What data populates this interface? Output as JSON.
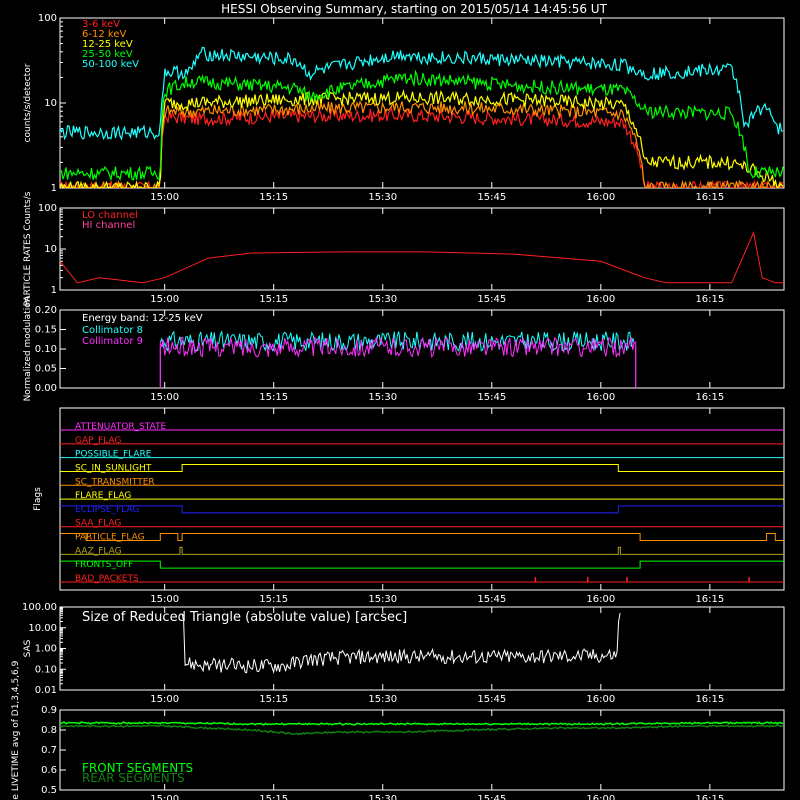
{
  "title": "HESSI Observing Summary, starting on 2015/05/14 14:45:56 UT",
  "time_ticks": [
    "15:00",
    "15:15",
    "15:30",
    "15:45",
    "16:00",
    "16:15"
  ],
  "colors": {
    "red": "#ff2020",
    "orange": "#ff9000",
    "yellow": "#ffff00",
    "green": "#00ff00",
    "cyan": "#20ffff",
    "magenta": "#ff30ff",
    "blue": "#2020ff",
    "white": "#ffffff",
    "olive": "#b0a020",
    "darkgreen": "#108010",
    "pink": "#ff40a0",
    "frame": "#ffffff"
  },
  "chart_data": [
    {
      "id": "counts",
      "type": "line",
      "ylabel": "counts/s/detector",
      "scale": "log",
      "ylim": [
        1,
        100
      ],
      "yticks": [
        "1",
        "10",
        "100"
      ],
      "series": [
        {
          "name": "3-6 keV",
          "color": "red",
          "x": [
            14.76,
            14.99,
            15.0,
            15.06,
            15.3,
            15.55,
            15.8,
            16.05,
            16.1,
            16.42
          ],
          "y": [
            1.0,
            1.0,
            7.0,
            6.5,
            7.0,
            7.2,
            6.5,
            6.0,
            1.0,
            1.0
          ]
        },
        {
          "name": "6-12 keV",
          "color": "orange",
          "x": [
            14.76,
            14.99,
            15.0,
            15.06,
            15.3,
            15.55,
            15.8,
            16.05,
            16.1,
            16.42
          ],
          "y": [
            1.0,
            1.0,
            8.0,
            8.0,
            8.5,
            9.0,
            8.5,
            7.5,
            1.0,
            1.0
          ]
        },
        {
          "name": "12-25 keV",
          "color": "yellow",
          "x": [
            14.76,
            14.99,
            15.0,
            15.06,
            15.3,
            15.55,
            15.8,
            16.05,
            16.1,
            16.3,
            16.42
          ],
          "y": [
            1.0,
            1.0,
            10.0,
            10.0,
            11.0,
            11.5,
            11.0,
            9.5,
            2.0,
            2.0,
            1.0
          ]
        },
        {
          "name": "25-50 keV",
          "color": "green",
          "x": [
            14.76,
            14.99,
            15.0,
            15.06,
            15.3,
            15.33,
            15.55,
            15.8,
            16.05,
            16.1,
            16.3,
            16.34,
            16.42
          ],
          "y": [
            1.5,
            1.5,
            14.0,
            18.0,
            15.0,
            12.0,
            20.0,
            16.0,
            14.0,
            8.0,
            7.5,
            1.5,
            1.5
          ]
        },
        {
          "name": "50-100 keV",
          "color": "cyan",
          "x": [
            14.76,
            14.99,
            15.0,
            15.06,
            15.08,
            15.3,
            15.33,
            15.55,
            15.58,
            15.8,
            16.05,
            16.1,
            16.3,
            16.33,
            16.38,
            16.4,
            16.42
          ],
          "y": [
            4.5,
            4.5,
            23.0,
            23.0,
            38.0,
            32.0,
            22.0,
            38.0,
            35.0,
            32.0,
            28.0,
            22.0,
            25.0,
            5.0,
            10.0,
            5.0,
            5.0
          ]
        }
      ]
    },
    {
      "id": "particle",
      "type": "line",
      "ylabel": "PARTICLE RATES Counts/s",
      "scale": "log",
      "ylim": [
        1,
        100
      ],
      "yticks": [
        "1",
        "10",
        "100"
      ],
      "series": [
        {
          "name": "LO channel",
          "color": "red",
          "x": [
            14.76,
            14.8,
            14.85,
            14.95,
            15.0,
            15.1,
            15.2,
            15.4,
            15.6,
            15.8,
            16.0,
            16.1,
            16.15,
            16.3,
            16.35,
            16.37,
            16.4,
            16.42
          ],
          "y": [
            5.0,
            1.5,
            2.0,
            1.5,
            2.0,
            6.0,
            8.0,
            8.5,
            8.5,
            7.5,
            5.0,
            2.0,
            1.5,
            1.5,
            25.0,
            2.0,
            1.5,
            1.5
          ]
        },
        {
          "name": "HI channel",
          "color": "pink",
          "x": [],
          "y": []
        }
      ]
    },
    {
      "id": "modulation",
      "type": "line",
      "ylabel": "Normalized modulation",
      "scale": "linear",
      "ylim": [
        0,
        0.2
      ],
      "yticks": [
        "0.00",
        "0.05",
        "0.10",
        "0.15",
        "0.20"
      ],
      "energy_label": "Energy band: 12-25 keV",
      "series": [
        {
          "name": "Collimator 8",
          "color": "cyan",
          "x": [
            14.99,
            16.08
          ],
          "y": [
            0.12,
            0.12
          ]
        },
        {
          "name": "Collimator 9",
          "color": "magenta",
          "x": [
            14.99,
            16.08
          ],
          "y": [
            0.105,
            0.105
          ]
        }
      ]
    },
    {
      "id": "flags",
      "type": "line",
      "ylabel": "Flags",
      "series": [
        {
          "name": "ATTENUATOR_STATE",
          "color": "magenta",
          "x": [
            14.76,
            16.42
          ],
          "y": [
            0,
            0
          ]
        },
        {
          "name": "GAP_FLAG",
          "color": "red",
          "x": [
            14.76,
            16.42
          ],
          "y": [
            0,
            0
          ]
        },
        {
          "name": "POSSIBLE_FLARE",
          "color": "cyan",
          "x": [
            14.76,
            16.42
          ],
          "y": [
            0,
            0
          ]
        },
        {
          "name": "SC_IN_SUNLIGHT",
          "color": "yellow",
          "x": [
            14.76,
            15.04,
            15.04,
            16.04,
            16.04,
            16.42
          ],
          "y": [
            0,
            0,
            1,
            1,
            0,
            0
          ]
        },
        {
          "name": "SC_TRANSMITTER",
          "color": "orange",
          "x": [
            14.76,
            16.42
          ],
          "y": [
            0,
            0
          ]
        },
        {
          "name": "FLARE_FLAG",
          "color": "yellow",
          "x": [
            14.76,
            16.42
          ],
          "y": [
            0,
            0
          ]
        },
        {
          "name": "ECLIPSE_FLAG",
          "color": "blue",
          "x": [
            14.76,
            15.04,
            15.04,
            16.04,
            16.04,
            16.42
          ],
          "y": [
            1,
            1,
            0,
            0,
            1,
            1
          ]
        },
        {
          "name": "SAA_FLAG",
          "color": "red",
          "x": [
            14.76,
            16.42
          ],
          "y": [
            0,
            0
          ]
        },
        {
          "name": "PARTICLE_FLAG",
          "color": "orange",
          "x": [
            14.76,
            14.82,
            14.82,
            14.99,
            14.99,
            15.03,
            15.03,
            15.04,
            15.04,
            16.09,
            16.09,
            16.38,
            16.38,
            16.4,
            16.4,
            16.42
          ],
          "y": [
            1,
            1,
            0,
            0,
            1,
            1,
            0,
            0,
            1,
            1,
            0,
            0,
            1,
            1,
            0,
            0
          ]
        },
        {
          "name": "AAZ_FLAG",
          "color": "olive",
          "x": [
            14.76,
            15.035,
            15.035,
            15.04,
            15.04,
            16.04,
            16.04,
            16.045,
            16.045,
            16.42
          ],
          "y": [
            0,
            0,
            1,
            1,
            0,
            0,
            1,
            1,
            0,
            0
          ]
        },
        {
          "name": "FRONTS_OFF",
          "color": "green",
          "x": [
            14.76,
            14.99,
            14.99,
            16.09,
            16.09,
            16.42
          ],
          "y": [
            1,
            1,
            0,
            0,
            1,
            1
          ]
        },
        {
          "name": "BAD_PACKETS",
          "color": "red",
          "x": [
            14.76,
            16.42
          ],
          "y": [
            0,
            0
          ],
          "spikes": [
            15.85,
            15.97,
            16.06,
            16.34
          ]
        }
      ]
    },
    {
      "id": "sas",
      "type": "line",
      "ylabel": "SAS",
      "scale": "log",
      "ylim": [
        0.01,
        100
      ],
      "yticks": [
        "0.01",
        "0.10",
        "1.00",
        "10.00",
        "100.00"
      ],
      "series": [
        {
          "name": "Size of Reduced Triangle (absolute value) [arcsec]",
          "color": "white",
          "x": [
            15.04,
            15.045,
            15.1,
            15.2,
            15.28,
            15.33,
            15.45,
            15.6,
            15.8,
            16.0,
            16.04,
            16.045
          ],
          "y": [
            100.0,
            0.2,
            0.15,
            0.15,
            0.15,
            0.3,
            0.4,
            0.4,
            0.4,
            0.45,
            0.5,
            100.0
          ]
        }
      ]
    },
    {
      "id": "livetime",
      "type": "line",
      "ylabel": "Mon. Rate LIVETIME avg of D1,3,4,5,6,9",
      "scale": "linear",
      "ylim": [
        0.5,
        0.9
      ],
      "yticks": [
        "0.5",
        "0.6",
        "0.7",
        "0.8",
        "0.9"
      ],
      "series": [
        {
          "name": "FRONT SEGMENTS",
          "color": "green",
          "x": [
            14.76,
            15.0,
            15.2,
            15.4,
            15.6,
            15.8,
            16.0,
            16.2,
            16.42
          ],
          "y": [
            0.835,
            0.835,
            0.83,
            0.83,
            0.83,
            0.83,
            0.83,
            0.835,
            0.835
          ]
        },
        {
          "name": "REAR SEGMENTS",
          "color": "darkgreen",
          "x": [
            14.76,
            15.0,
            15.2,
            15.3,
            15.4,
            15.55,
            15.7,
            15.9,
            16.05,
            16.2,
            16.42
          ],
          "y": [
            0.82,
            0.82,
            0.8,
            0.78,
            0.79,
            0.79,
            0.8,
            0.81,
            0.81,
            0.82,
            0.82
          ]
        }
      ]
    }
  ]
}
